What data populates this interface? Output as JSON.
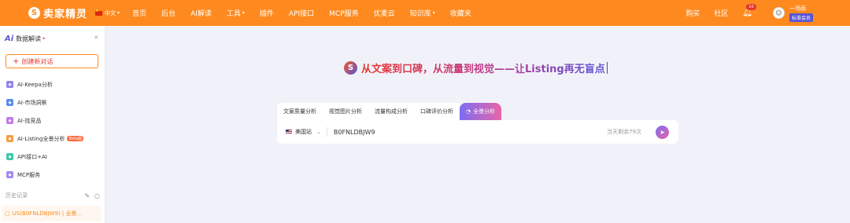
{
  "header": {
    "logo_mark": "S",
    "logo_text": "卖家精灵",
    "region": "中文",
    "nav": [
      "首页",
      "后台",
      "AI解读",
      "工具",
      "插件",
      "API接口",
      "MCP服务",
      "优麦云",
      "知识库",
      "收藏夹"
    ],
    "nav_with_caret": [
      false,
      false,
      false,
      true,
      false,
      false,
      false,
      false,
      true,
      false
    ],
    "right_nav": [
      "购买",
      "社区"
    ],
    "notification_count": "10",
    "user_name": "一场雨",
    "member_level": "标准会员"
  },
  "sidebar": {
    "logo": "Ai",
    "title": "数据解读",
    "new_chat": "创建新对话",
    "items": [
      {
        "label": "AI-Keepa分析",
        "icon": "keepa-icon",
        "color": "#8f86ef"
      },
      {
        "label": "AI-市场洞察",
        "icon": "market-icon",
        "color": "#5b8def"
      },
      {
        "label": "AI-找竞品",
        "icon": "competitor-icon",
        "color": "#c27be8"
      },
      {
        "label": "AI-Listing全景分析",
        "icon": "listing-icon",
        "color": "#f59e42",
        "badge": "Beta版"
      },
      {
        "label": "API接口+AI",
        "icon": "api-icon",
        "color": "#3ec9a7"
      },
      {
        "label": "MCP服务",
        "icon": "mcp-icon",
        "color": "#a68af0"
      }
    ],
    "history_title": "历史记录",
    "history_items": [
      "US(B0FNLDBJW9) | 全景..."
    ]
  },
  "main": {
    "headline": "从文案到口碑，从流量到视觉——让Listing再无盲点",
    "tabs": [
      "文案质量分析",
      "视觉图片分析",
      "流量构成分析",
      "口碑评价分析",
      "全景分析"
    ],
    "active_tab": 4,
    "site": "美国站",
    "asin_value": "B0FNLDBJW9",
    "remaining": "当天剩余79次"
  },
  "colors": {
    "brand_orange": "#fe8a1f",
    "accent_purple": "#5a54d6",
    "accent_pink": "#e865a6"
  }
}
